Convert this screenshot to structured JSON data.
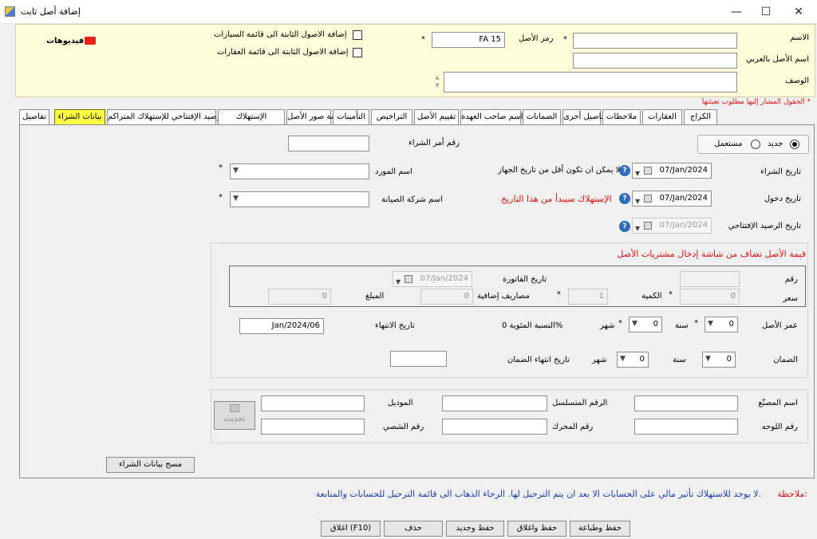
{
  "window": {
    "title": "إضافة أصل ثابت",
    "minimize": "—",
    "maximize": "☐",
    "close": "✕"
  },
  "header": {
    "name_label": "الاسم",
    "name_value": "",
    "arabic_name_label": "اسم الأصل بالعربي",
    "arabic_name_value": "",
    "description_label": "الوصف",
    "description_value": "",
    "asset_code_label": "رمز الأصل",
    "asset_code_value": "FA 15",
    "add_to_cars_label": "إضافة الاصول الثابتة الى قائمة السيارات",
    "add_to_realestate_label": "إضافة الاصول الثابتة الى قائمة العقارات",
    "videos_label": "فيديوهات",
    "required_note": "الحقول المشار إليها مطلوب تعبئتها *",
    "star": "*"
  },
  "tabs": [
    {
      "label": "تفاصيل"
    },
    {
      "label": "بيانات الشراء",
      "active": true
    },
    {
      "label": "الرصيد الإفتتاحي للإستهلاك المتراكم"
    },
    {
      "label": "الإستهلاك"
    },
    {
      "label": "قائمة صور الأصل"
    },
    {
      "label": "التأمينات"
    },
    {
      "label": "التراخيص"
    },
    {
      "label": "تقييم الأصل"
    },
    {
      "label": "اسم صاحب العهدة"
    },
    {
      "label": "الضمانات"
    },
    {
      "label": "تفاصيل أخرى"
    },
    {
      "label": "ملاحظات"
    },
    {
      "label": "العقارات"
    },
    {
      "label": "الكراج"
    }
  ],
  "purchase": {
    "new_label": "جديد",
    "used_label": "مستعمل",
    "po_label": "رقم أمر الشراء",
    "po_value": "",
    "purchase_date_label": "تاريخ الشراء",
    "purchase_date_value": "07/Jan/2024",
    "purchase_date_hint": "لا يمكن ان تكون أقل من تاريخ الجهاز",
    "entry_date_label": "تاريخ دخول",
    "entry_date_value": "07/Jan/2024",
    "entry_date_hint": "الإستهلاك سيبدأ من هذا التاريخ",
    "opening_date_label": "تاريخ الرصيد الإفتتاحي",
    "opening_date_value": "07/Jan/2024",
    "supplier_label": "اسم المورد",
    "supplier_value": "",
    "maintenance_label": "اسم شركة الصيانة",
    "maintenance_value": "",
    "help": "?"
  },
  "value_section": {
    "heading": "قيمة الأصل تضاف من شاشة إدخال مشتريات الأصل",
    "number_label": "رقم",
    "number_value": "",
    "invoice_date_label": "تاريخ الفاتورة",
    "invoice_date_value": "07/Jan/2024",
    "price_label": "سعر",
    "price_value": "0",
    "qty_label": "الكمية",
    "qty_value": "1",
    "extra_label": "مصاريف إضافية",
    "extra_value": "0",
    "amount_label": "المبلغ",
    "amount_value": "0",
    "age_label": "عمر الأصل",
    "age_years": "0",
    "years_label": "سنة",
    "age_months": "0",
    "months_label": "شهر",
    "percent_label": "النسبة المئوية 0%",
    "end_date_label": "تاريخ الانتهاء",
    "end_date_value": "Jan/2024/06",
    "warranty_label": "الضمان",
    "warranty_years": "0",
    "warranty_months": "0",
    "warranty_end_label": "تاريخ انتهاء الضمان",
    "warranty_end_value": ""
  },
  "vehicle": {
    "manufacturer_label": "اسم المصنّع",
    "serial_label": "الرقم المتسلسل",
    "model_label": "الموديل",
    "plate_label": "رقم اللوحه",
    "engine_label": "رقم المحرك",
    "chassis_label": "رقم الشصي",
    "update_label": "تحديث"
  },
  "clear_button": "مسح بيانات الشراء",
  "note_label": "ملاحظة:",
  "note_text": "لا يوجد للاستهلاك تأثير مالي على الحسابات الا بعد ان يتم الترحيل لها. الرجاء الذهاب الى قائمة الترحيل للحسابات والمتابعة.",
  "footer": {
    "save_print": "حفظ وطباعة",
    "save_close": "حفظ واغلاق",
    "save_new": "حفظ وجديد",
    "delete": "حذف",
    "close": "اغلاق (F10)"
  }
}
